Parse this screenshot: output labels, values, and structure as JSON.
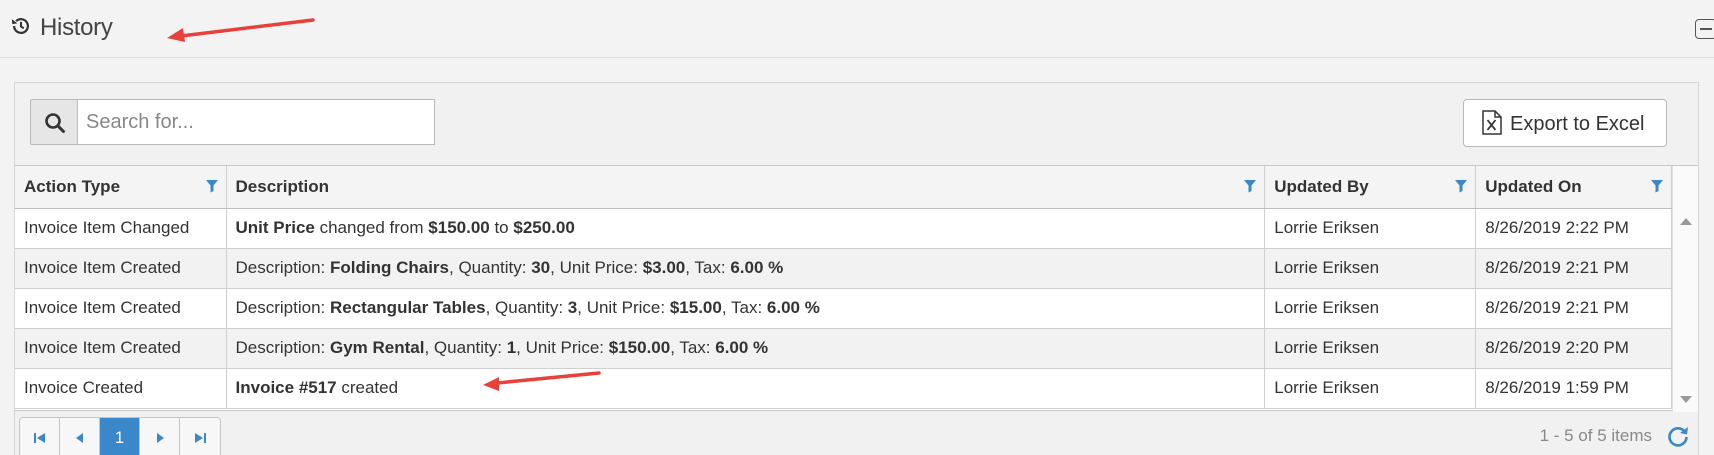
{
  "header": {
    "title": "History",
    "icon": "history-icon",
    "collapse_icon": "collapse-icon"
  },
  "toolbar": {
    "search_placeholder": "Search for...",
    "search_value": "",
    "export_label": "Export to Excel",
    "export_icon": "excel-file-icon"
  },
  "grid": {
    "columns": [
      {
        "label": "Action Type"
      },
      {
        "label": "Description"
      },
      {
        "label": "Updated By"
      },
      {
        "label": "Updated On"
      }
    ],
    "rows": [
      {
        "action": "Invoice Item Changed",
        "desc": [
          {
            "b": true,
            "t": "Unit Price"
          },
          {
            "t": " changed from "
          },
          {
            "b": true,
            "t": "$150.00"
          },
          {
            "t": " to "
          },
          {
            "b": true,
            "t": "$250.00"
          }
        ],
        "by": "Lorrie Eriksen",
        "on": "8/26/2019 2:22 PM"
      },
      {
        "action": "Invoice Item Created",
        "desc": [
          {
            "t": "Description: "
          },
          {
            "b": true,
            "t": "Folding Chairs"
          },
          {
            "t": ", Quantity: "
          },
          {
            "b": true,
            "t": "30"
          },
          {
            "t": ", Unit Price: "
          },
          {
            "b": true,
            "t": "$3.00"
          },
          {
            "t": ", Tax: "
          },
          {
            "b": true,
            "t": "6.00 %"
          }
        ],
        "by": "Lorrie Eriksen",
        "on": "8/26/2019 2:21 PM"
      },
      {
        "action": "Invoice Item Created",
        "desc": [
          {
            "t": "Description: "
          },
          {
            "b": true,
            "t": "Rectangular Tables"
          },
          {
            "t": ", Quantity: "
          },
          {
            "b": true,
            "t": "3"
          },
          {
            "t": ", Unit Price: "
          },
          {
            "b": true,
            "t": "$15.00"
          },
          {
            "t": ", Tax: "
          },
          {
            "b": true,
            "t": "6.00 %"
          }
        ],
        "by": "Lorrie Eriksen",
        "on": "8/26/2019 2:21 PM"
      },
      {
        "action": "Invoice Item Created",
        "desc": [
          {
            "t": "Description: "
          },
          {
            "b": true,
            "t": "Gym Rental"
          },
          {
            "t": ", Quantity: "
          },
          {
            "b": true,
            "t": "1"
          },
          {
            "t": ", Unit Price: "
          },
          {
            "b": true,
            "t": "$150.00"
          },
          {
            "t": ", Tax: "
          },
          {
            "b": true,
            "t": "6.00 %"
          }
        ],
        "by": "Lorrie Eriksen",
        "on": "8/26/2019 2:20 PM"
      },
      {
        "action": "Invoice Created",
        "desc": [
          {
            "b": true,
            "t": "Invoice #517"
          },
          {
            "t": " created"
          }
        ],
        "by": "Lorrie Eriksen",
        "on": "8/26/2019 1:59 PM"
      }
    ]
  },
  "pager": {
    "current_page": "1",
    "summary": "1 - 5 of 5 items"
  },
  "colors": {
    "accent": "#3a87c9",
    "annotation_arrow": "#e8413c"
  }
}
